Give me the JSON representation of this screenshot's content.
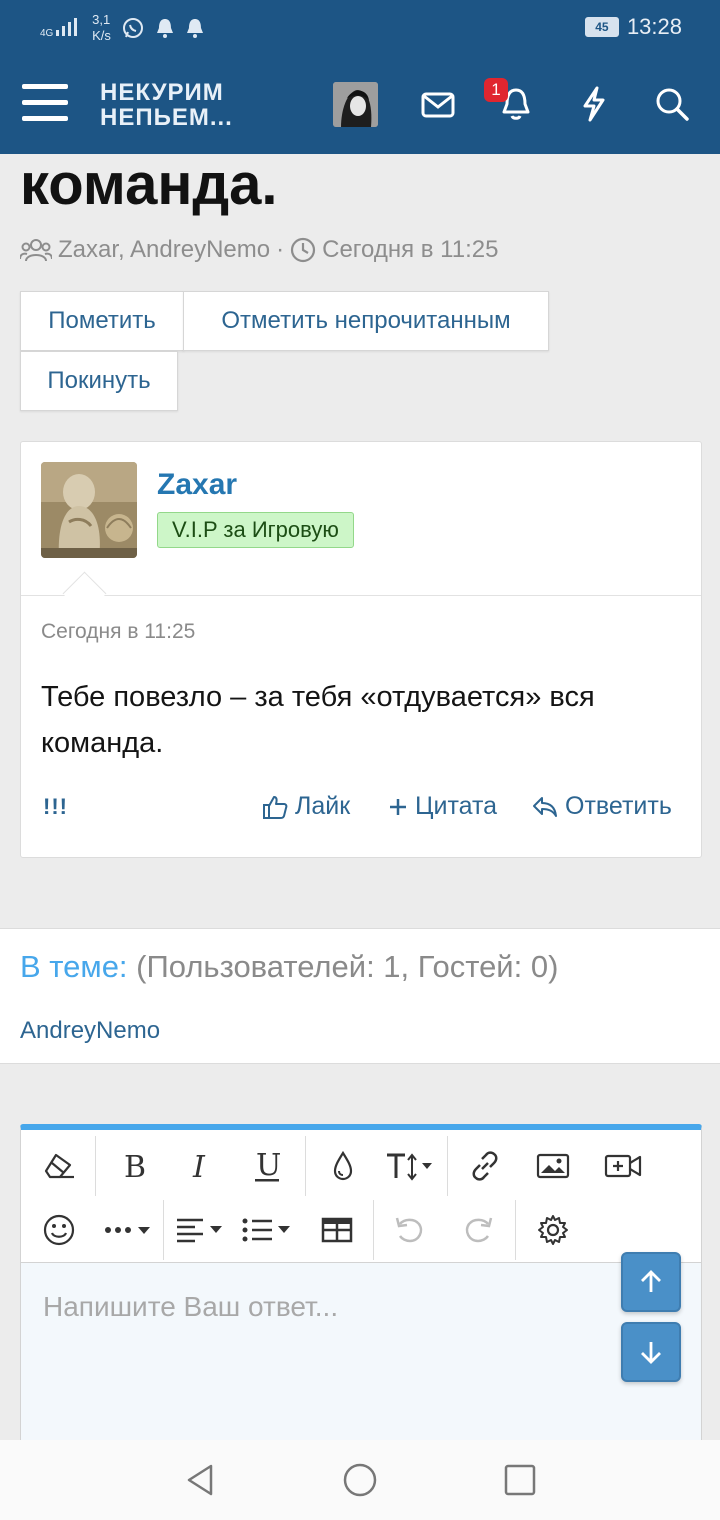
{
  "status": {
    "network": "4G",
    "speed_value": "3,1",
    "speed_unit": "K/s",
    "battery": "45",
    "time": "13:28"
  },
  "header": {
    "logo_line1": "НЕКУРИМ",
    "logo_line2": "НЕПЬЕМ...",
    "notification_count": "1"
  },
  "thread": {
    "title": "команда.",
    "participants": "Zaxar, AndreyNemo",
    "separator": "·",
    "date": "Сегодня в 11:25"
  },
  "thread_buttons": {
    "mark": "Пометить",
    "mark_unread": "Отметить непрочитанным",
    "leave": "Покинуть"
  },
  "post": {
    "username": "Zaxar",
    "user_banner": "V.I.P за Игровую",
    "date": "Сегодня в 11:25",
    "body": "Тебе повезло – за тебя «отдувается» вся команда.",
    "report": "!!!",
    "like": "Лайк",
    "quote": "Цитата",
    "reply": "Ответить"
  },
  "online": {
    "label": "В теме:",
    "counts": "(Пользователей: 1, Гостей: 0)",
    "users": [
      "AndreyNemo"
    ]
  },
  "editor": {
    "placeholder": "Напишите Ваш ответ..."
  },
  "colors": {
    "header_bg": "#1d5585",
    "accent": "#47a7eb",
    "link": "#2d6591",
    "banner_bg": "#cdf6c8"
  }
}
